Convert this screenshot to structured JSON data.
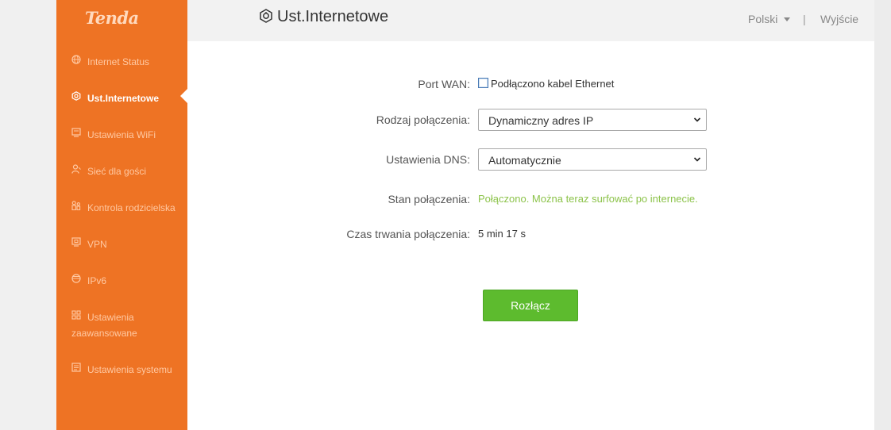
{
  "sidebar": {
    "logo": "Tenda",
    "items": [
      {
        "label": "Internet Status",
        "icon": "globe-icon"
      },
      {
        "label": "Ust.Internetowe",
        "icon": "internet-settings-icon",
        "active": true
      },
      {
        "label": "Ustawienia WiFi",
        "icon": "wifi-settings-icon"
      },
      {
        "label": "Sieć dla gości",
        "icon": "guest-icon"
      },
      {
        "label": "Kontrola rodzicielska",
        "icon": "parental-icon"
      },
      {
        "label": "VPN",
        "icon": "vpn-icon"
      },
      {
        "label": "IPv6",
        "icon": "ipv6-icon"
      },
      {
        "label": "Ustawienia zaawansowane",
        "icon": "advanced-icon"
      },
      {
        "label": "Ustawienia systemu",
        "icon": "system-icon"
      }
    ]
  },
  "header": {
    "title": "Ust.Internetowe",
    "language": "Polski",
    "separator": "|",
    "logout": "Wyjście"
  },
  "form": {
    "port_wan": {
      "label": "Port WAN:",
      "value": "Podłączono kabel Ethernet"
    },
    "connection_type": {
      "label": "Rodzaj połączenia:",
      "value": "Dynamiczny adres IP"
    },
    "dns": {
      "label": "Ustawienia DNS:",
      "value": "Automatycznie"
    },
    "status": {
      "label": "Stan połączenia:",
      "value": "Połączono. Można teraz surfować po internecie."
    },
    "duration": {
      "label": "Czas trwania połączenia:",
      "value": "5 min 17 s"
    },
    "disconnect_button": "Rozłącz"
  },
  "colors": {
    "sidebar": "#ee7324",
    "status_ok": "#8cc34a",
    "button": "#5dbb2e"
  }
}
